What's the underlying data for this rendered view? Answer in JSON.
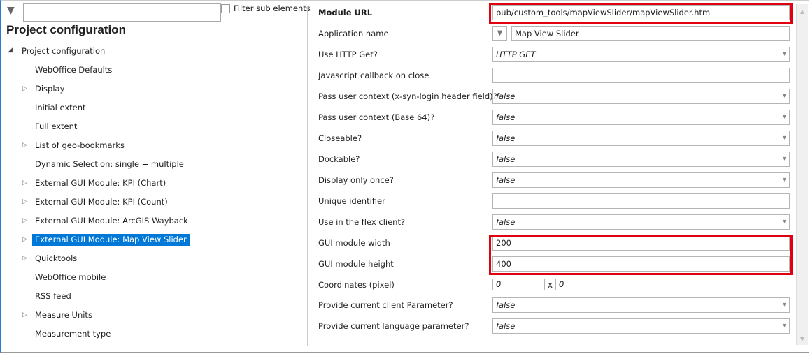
{
  "left": {
    "filter_placeholder": "",
    "filter_sub_label": "Filter sub elements",
    "title": "Project configuration",
    "root": "Project configuration",
    "items": [
      {
        "label": "WebOffice Defaults",
        "expandable": false
      },
      {
        "label": "Display",
        "expandable": true
      },
      {
        "label": "Initial extent",
        "expandable": false
      },
      {
        "label": "Full extent",
        "expandable": false
      },
      {
        "label": "List of geo-bookmarks",
        "expandable": true
      },
      {
        "label": "Dynamic Selection: single + multiple",
        "expandable": false
      },
      {
        "label": "External GUI Module: KPI (Chart)",
        "expandable": true
      },
      {
        "label": "External GUI Module: KPI (Count)",
        "expandable": true
      },
      {
        "label": "External GUI Module: ArcGIS Wayback",
        "expandable": true
      },
      {
        "label": "External GUI Module: Map View Slider",
        "expandable": true,
        "selected": true
      },
      {
        "label": "Quicktools",
        "expandable": true
      },
      {
        "label": "WebOffice mobile",
        "expandable": false
      },
      {
        "label": "RSS feed",
        "expandable": false
      },
      {
        "label": "Measure Units",
        "expandable": true
      },
      {
        "label": "Measurement type",
        "expandable": false
      }
    ]
  },
  "props": [
    {
      "label": "Module URL",
      "value": "pub/custom_tools/mapViewSlider/mapViewSlider.htm"
    },
    {
      "label": "Application name",
      "value": "Map View Slider"
    },
    {
      "label": "Use HTTP Get?",
      "value": "HTTP GET"
    },
    {
      "label": "Javascript callback on close",
      "value": ""
    },
    {
      "label": "Pass user context (x-syn-login header field)?",
      "value": "false"
    },
    {
      "label": "Pass user context (Base 64)?",
      "value": "false"
    },
    {
      "label": "Closeable?",
      "value": "false"
    },
    {
      "label": "Dockable?",
      "value": "false"
    },
    {
      "label": "Display only once?",
      "value": "false"
    },
    {
      "label": "Unique identifier",
      "value": ""
    },
    {
      "label": "Use in the flex client?",
      "value": "false"
    },
    {
      "label": "GUI module width",
      "value": "200"
    },
    {
      "label": "GUI module height",
      "value": "400"
    },
    {
      "label": "Coordinates (pixel)",
      "x": "0",
      "sep": "x",
      "y": "0"
    },
    {
      "label": "Provide current client Parameter?",
      "value": "false"
    },
    {
      "label": "Provide current language parameter?",
      "value": "false"
    }
  ]
}
